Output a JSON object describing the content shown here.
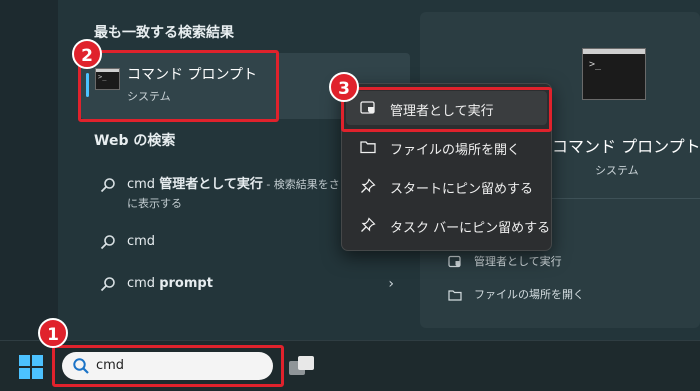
{
  "start_menu": {
    "best_match_header": "最も一致する検索結果",
    "best_match": {
      "name": "コマンド プロンプト",
      "type": "システム"
    },
    "web_header": "Web の検索",
    "web_results": [
      {
        "plain": "cmd ",
        "bold": "管理者として実行",
        "suffix": " - 検索結果をさら",
        "line2": "に表示する"
      },
      {
        "plain": "cmd",
        "bold": ""
      },
      {
        "plain": "cmd ",
        "bold": "prompt"
      }
    ],
    "details": {
      "name": "コマンド プロンプト",
      "type": "システム",
      "actions": [
        "管理者として実行",
        "ファイルの場所を開く"
      ]
    }
  },
  "context_menu": {
    "items": [
      "管理者として実行",
      "ファイルの場所を開く",
      "スタートにピン留めする",
      "タスク バーにピン留めする"
    ]
  },
  "taskbar": {
    "search_value": "cmd"
  },
  "annotations": {
    "step1": "1",
    "step2": "2",
    "step3": "3"
  },
  "colors": {
    "highlight": "#e0222c",
    "accent": "#4cc2ff"
  }
}
